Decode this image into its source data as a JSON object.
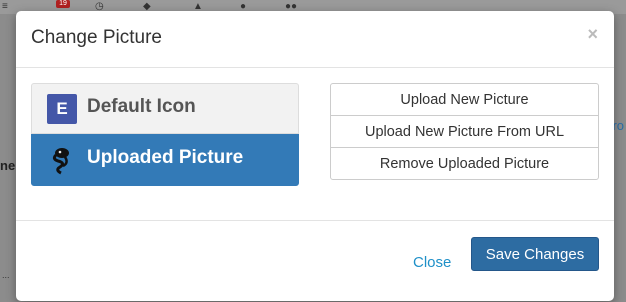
{
  "background": {
    "badge_count": "19",
    "left_fragment": "ne",
    "right_fragment": "ro",
    "bottom_fragment": "..."
  },
  "modal": {
    "title": "Change Picture",
    "close_glyph": "×",
    "options": [
      {
        "label": "Default Icon",
        "thumb_letter": "E",
        "selected": false
      },
      {
        "label": "Uploaded Picture",
        "selected": true
      }
    ],
    "actions": [
      {
        "label": "Upload New Picture"
      },
      {
        "label": "Upload New Picture From URL"
      },
      {
        "label": "Remove Uploaded Picture"
      }
    ],
    "footer": {
      "close_label": "Close",
      "save_label": "Save Changes"
    }
  },
  "colors": {
    "selected_bg": "#337ab7",
    "save_bg": "#2d6ca2",
    "link": "#1f90c8",
    "default_icon_bg": "#4457a8"
  }
}
